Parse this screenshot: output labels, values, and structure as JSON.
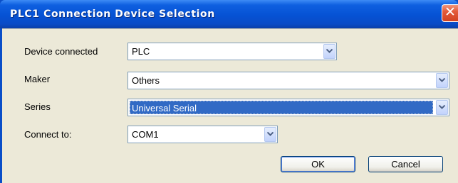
{
  "window": {
    "title": "PLC1 Connection Device Selection",
    "close_symbol": "✕"
  },
  "form": {
    "device_connected": {
      "label": "Device connected",
      "value": "PLC"
    },
    "maker": {
      "label": "Maker",
      "value": "Others"
    },
    "series": {
      "label": "Series",
      "value": "Universal Serial"
    },
    "connect_to": {
      "label": "Connect to:",
      "value": "COM1"
    }
  },
  "buttons": {
    "ok": "OK",
    "cancel": "Cancel"
  },
  "colors": {
    "titlebar": "#0652d4",
    "client_bg": "#ece9d8",
    "selection": "#316ac5"
  },
  "icons": [
    "close-icon",
    "chevron-down-icon"
  ]
}
